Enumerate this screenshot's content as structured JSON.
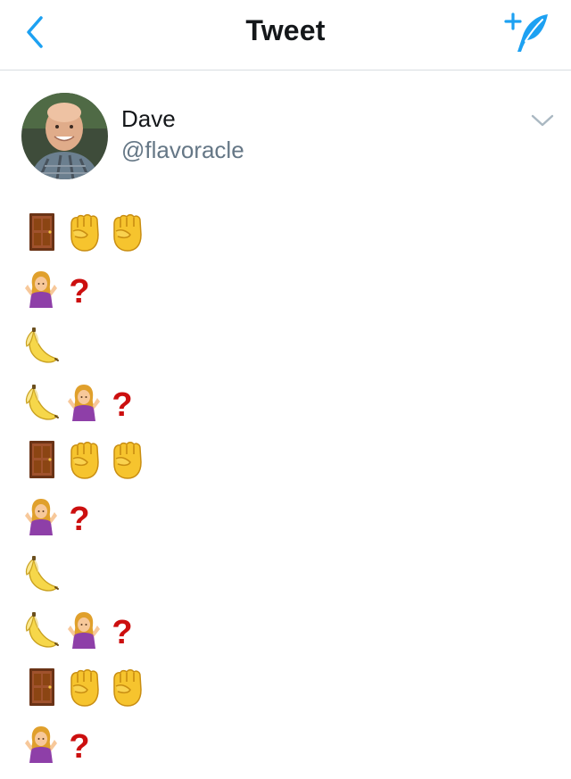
{
  "header": {
    "title": "Tweet",
    "back_icon": "chevron-left-icon",
    "compose_icon": "compose-tweet-icon",
    "accent_color": "#1da1f2"
  },
  "tweet": {
    "author": {
      "display_name": "Dave",
      "handle": "@flavoracle",
      "avatar_icon": "avatar"
    },
    "menu_icon": "chevron-down-icon",
    "lines": [
      [
        "door",
        "raised-fist",
        "raised-fist"
      ],
      [
        "person-shrugging",
        "question-mark"
      ],
      [
        "banana"
      ],
      [
        "banana",
        "person-shrugging",
        "question-mark"
      ],
      [
        "door",
        "raised-fist",
        "raised-fist"
      ],
      [
        "person-shrugging",
        "question-mark"
      ],
      [
        "banana"
      ],
      [
        "banana",
        "person-shrugging",
        "question-mark"
      ],
      [
        "door",
        "raised-fist",
        "raised-fist"
      ],
      [
        "person-shrugging",
        "question-mark"
      ]
    ]
  }
}
